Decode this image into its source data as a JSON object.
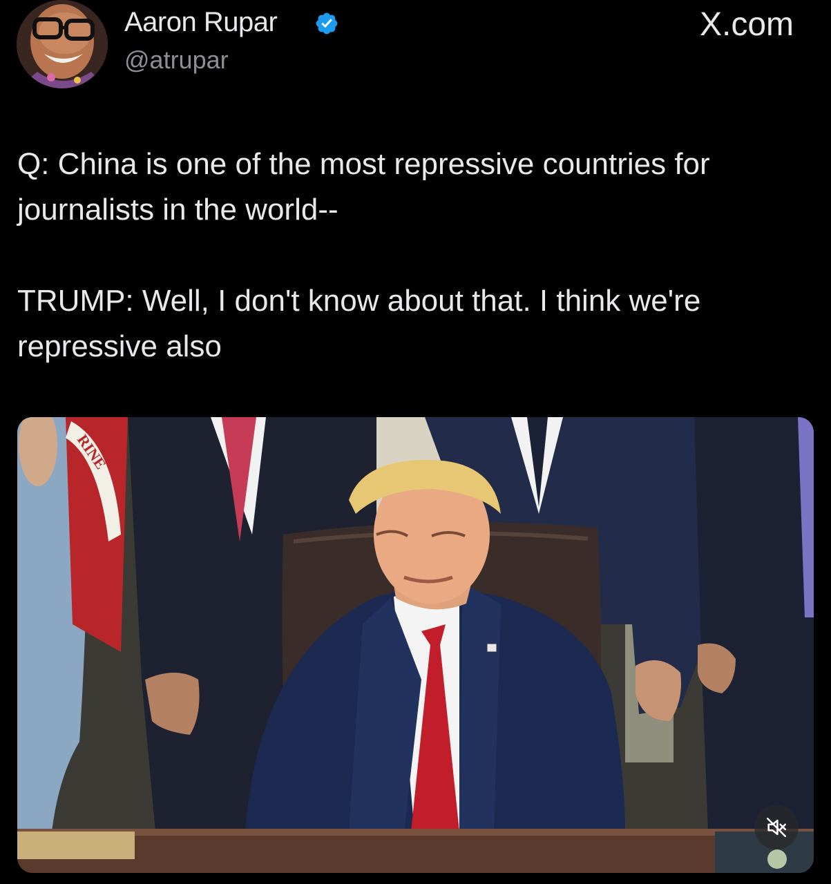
{
  "header": {
    "display_name": "Aaron Rupar",
    "handle": "@atrupar",
    "verified_icon": "verified-badge-icon",
    "site_label": "X.com"
  },
  "tweet": {
    "question_line": "Q: China is one of the most repressive countries for journalists in the world--",
    "answer_line": "TRUMP: Well, I don't know about that. I think we're repressive also"
  },
  "media": {
    "sash_text": "RINE",
    "mute_icon": "muted-speaker-icon"
  },
  "colors": {
    "background": "#000000",
    "text": "#e7e9ea",
    "secondary_text": "#8b9096",
    "verified_blue": "#1d9bf0"
  }
}
